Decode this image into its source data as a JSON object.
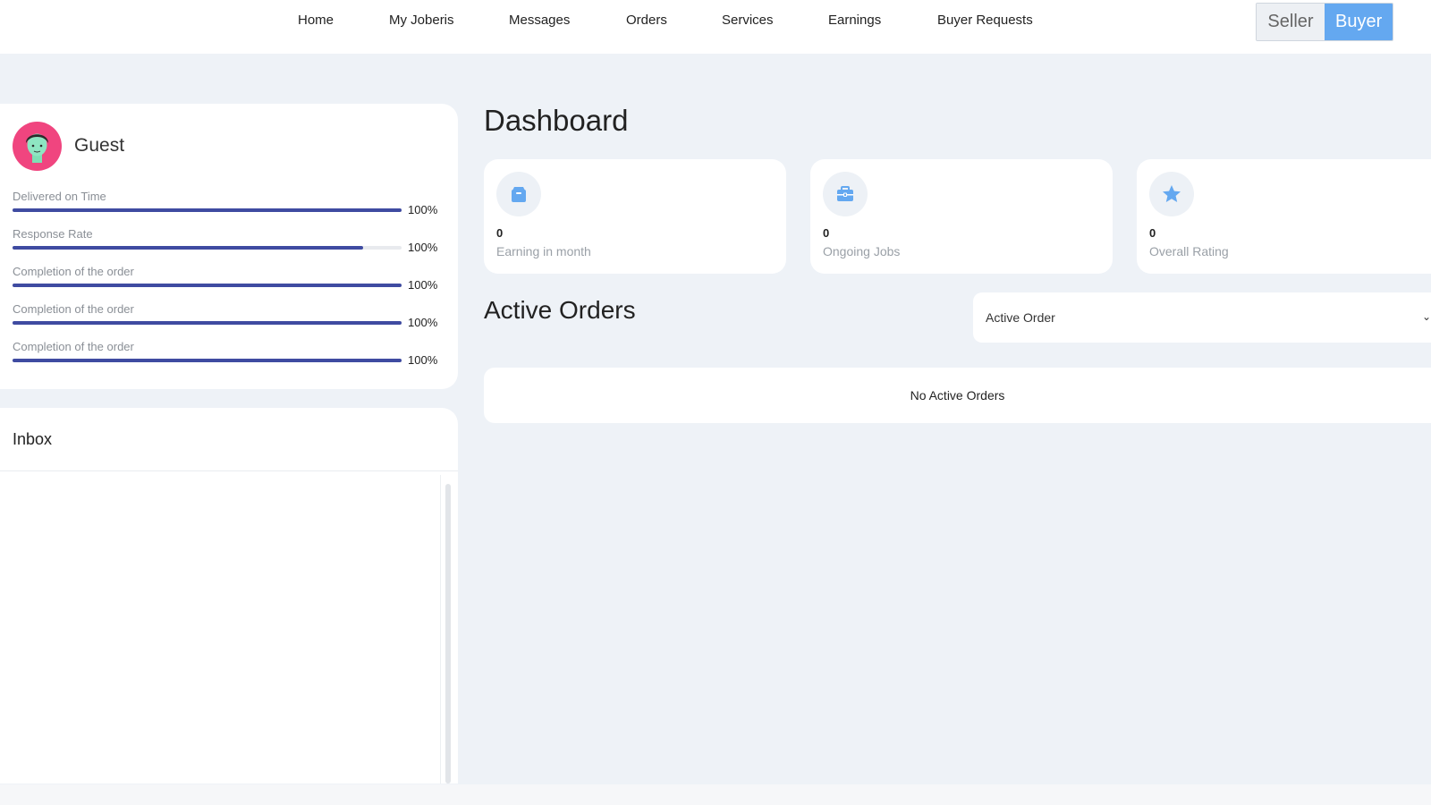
{
  "nav": {
    "links": [
      "Home",
      "My Joberis",
      "Messages",
      "Orders",
      "Services",
      "Earnings",
      "Buyer Requests"
    ]
  },
  "mode_switch": {
    "seller_label": "Seller",
    "buyer_label": "Buyer",
    "active": "Buyer"
  },
  "profile": {
    "name": "Guest",
    "avatar_color": "#f0457f",
    "metrics": [
      {
        "label": "Delivered on Time",
        "value": "100%",
        "fill": 1.0
      },
      {
        "label": "Response Rate",
        "value": "100%",
        "fill": 0.9
      },
      {
        "label": "Completion of the order",
        "value": "100%",
        "fill": 1.0
      },
      {
        "label": "Completion of the order",
        "value": "100%",
        "fill": 1.0
      },
      {
        "label": "Completion of the order",
        "value": "100%",
        "fill": 1.0
      }
    ]
  },
  "inbox": {
    "title": "Inbox"
  },
  "dashboard": {
    "title": "Dashboard",
    "stats": [
      {
        "value": "0",
        "label": "Earning in month",
        "icon": "wallet-icon"
      },
      {
        "value": "0",
        "label": "Ongoing Jobs",
        "icon": "briefcase-icon"
      },
      {
        "value": "0",
        "label": "Overall Rating",
        "icon": "star-icon"
      }
    ],
    "accent_color": "#64a8f0",
    "bar_color": "#3f4ba1"
  },
  "active_orders": {
    "title": "Active Orders",
    "filter_value": "Active Order",
    "empty_text": "No Active Orders"
  }
}
